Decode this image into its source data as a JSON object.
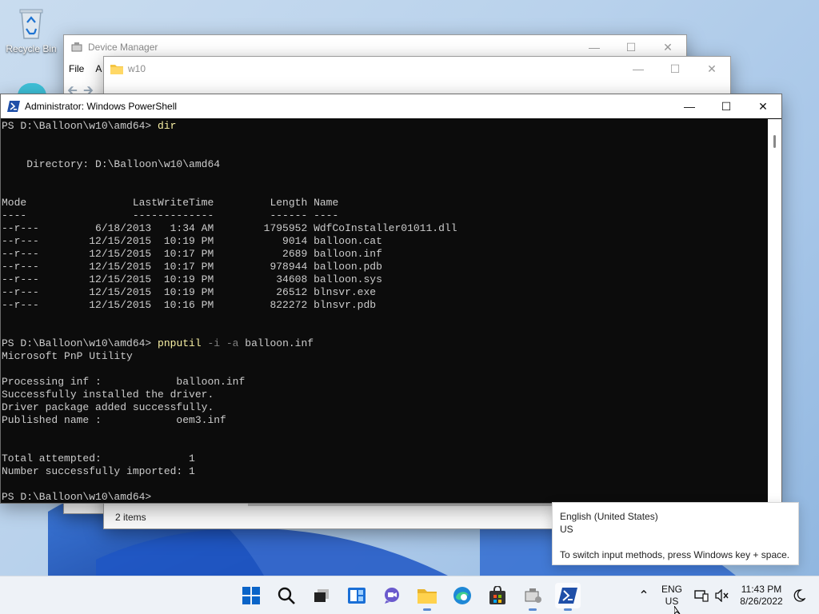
{
  "desktop": {
    "recycle_bin_label": "Recycle Bin"
  },
  "device_manager": {
    "title": "Device Manager",
    "menu": [
      "File",
      "A"
    ]
  },
  "explorer": {
    "title": "w10",
    "status": "2 items"
  },
  "powershell": {
    "title": "Administrator: Windows PowerShell",
    "lines": [
      {
        "text": "PS D:\\Balloon\\w10\\amd64> ",
        "cmd": "dir",
        "arg": "",
        "rest": ""
      },
      {
        "text": ""
      },
      {
        "text": ""
      },
      {
        "text": "    Directory: D:\\Balloon\\w10\\amd64"
      },
      {
        "text": ""
      },
      {
        "text": ""
      },
      {
        "text": "Mode                 LastWriteTime         Length Name"
      },
      {
        "text": "----                 -------------         ------ ----"
      },
      {
        "text": "--r---         6/18/2013   1:34 AM        1795952 WdfCoInstaller01011.dll"
      },
      {
        "text": "--r---        12/15/2015  10:19 PM           9014 balloon.cat"
      },
      {
        "text": "--r---        12/15/2015  10:17 PM           2689 balloon.inf"
      },
      {
        "text": "--r---        12/15/2015  10:17 PM         978944 balloon.pdb"
      },
      {
        "text": "--r---        12/15/2015  10:19 PM          34608 balloon.sys"
      },
      {
        "text": "--r---        12/15/2015  10:19 PM          26512 blnsvr.exe"
      },
      {
        "text": "--r---        12/15/2015  10:16 PM         822272 blnsvr.pdb"
      },
      {
        "text": ""
      },
      {
        "text": ""
      },
      {
        "text": "PS D:\\Balloon\\w10\\amd64> ",
        "cmd": "pnputil",
        "arg": " -i -a",
        "rest": " balloon.inf"
      },
      {
        "text": "Microsoft PnP Utility"
      },
      {
        "text": ""
      },
      {
        "text": "Processing inf :            balloon.inf"
      },
      {
        "text": "Successfully installed the driver."
      },
      {
        "text": "Driver package added successfully."
      },
      {
        "text": "Published name :            oem3.inf"
      },
      {
        "text": ""
      },
      {
        "text": ""
      },
      {
        "text": "Total attempted:              1"
      },
      {
        "text": "Number successfully imported: 1"
      },
      {
        "text": ""
      },
      {
        "text": "PS D:\\Balloon\\w10\\amd64>"
      }
    ]
  },
  "ime_tooltip": {
    "language": "English (United States)",
    "layout": "US",
    "hint": "To switch input methods, press Windows key + space."
  },
  "taskbar": {
    "lang_top": "ENG",
    "lang_bottom": "US",
    "time": "11:43 PM",
    "date": "8/26/2022",
    "accent": "#0a64c8"
  }
}
